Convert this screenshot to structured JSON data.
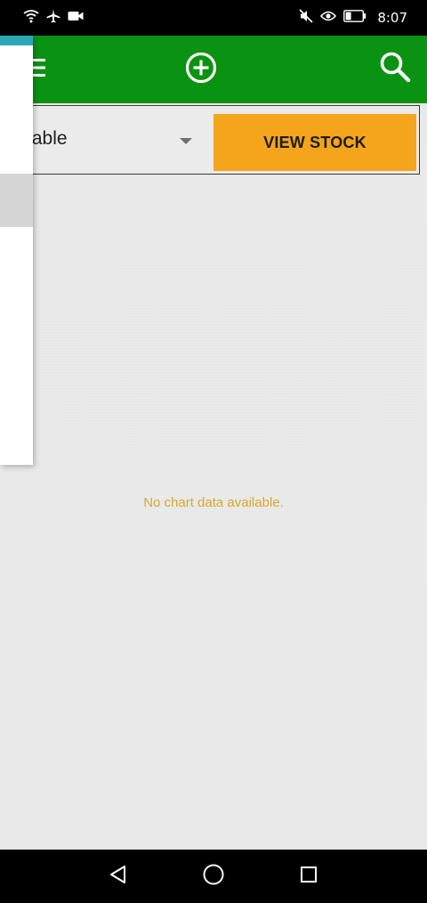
{
  "status_bar": {
    "time": "8:07",
    "icons": [
      "wifi-icon",
      "airplane-icon",
      "video-icon",
      "mute-icon",
      "eye-icon",
      "battery-icon"
    ]
  },
  "app_bar": {
    "background_color": "#0a9312",
    "icons": [
      "menu-icon",
      "add-circle-icon",
      "search-icon"
    ]
  },
  "filter": {
    "category_value": "egetable",
    "view_stock_label": "VIEW STOCK",
    "button_color": "#f5a51c"
  },
  "chart": {
    "empty_message": "No chart data available.",
    "message_color": "#d9a92c"
  },
  "drawer": {
    "accent_color": "#2ba7b8"
  },
  "nav_bar": {
    "icons": [
      "back-icon",
      "home-icon",
      "recent-apps-icon"
    ]
  }
}
